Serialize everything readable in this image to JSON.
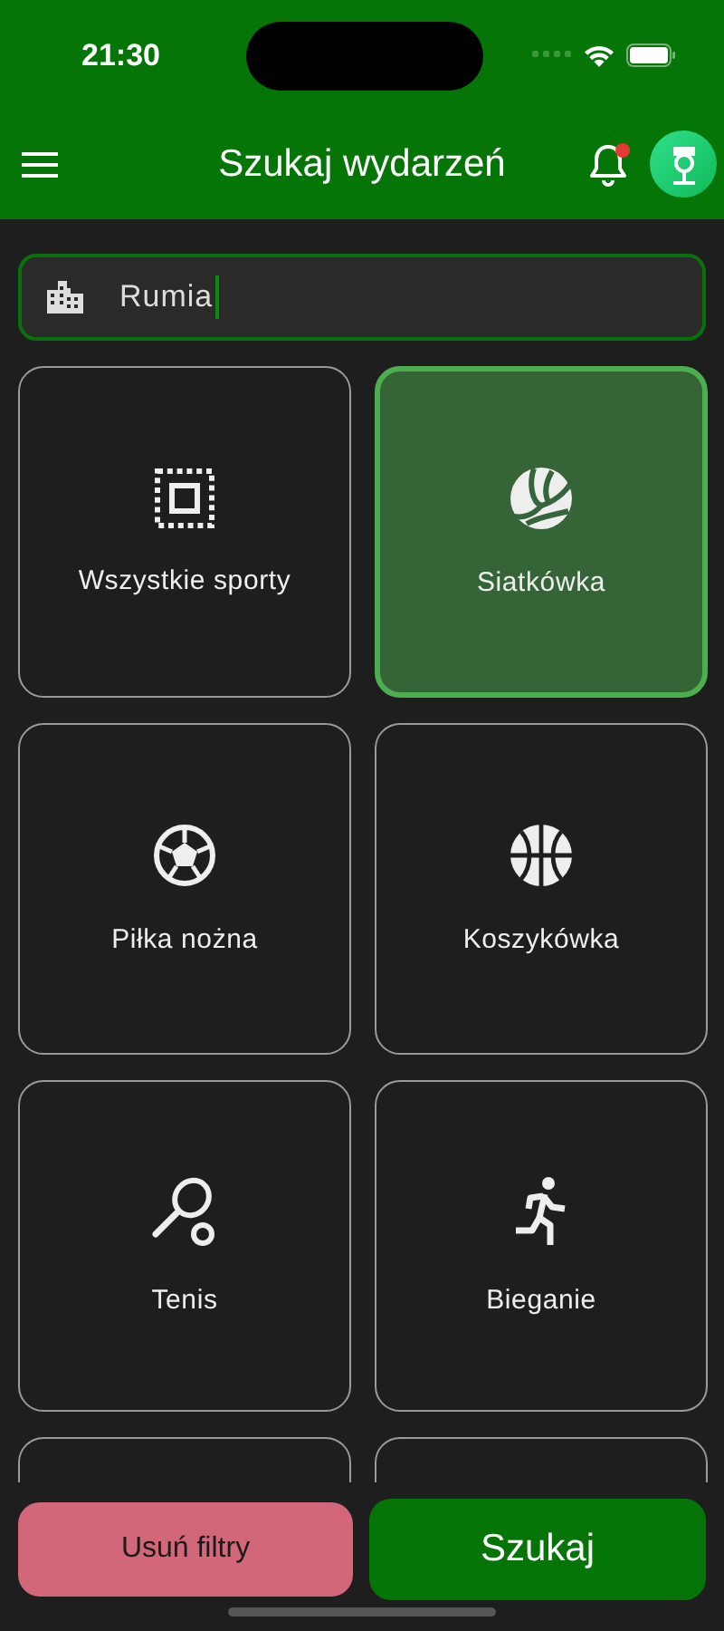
{
  "status_bar": {
    "time": "21:30"
  },
  "app_bar": {
    "title": "Szukaj wydarzeń",
    "notifications_unread": true
  },
  "location_field": {
    "value": "Rumia"
  },
  "sports": [
    {
      "kind": "all",
      "label": "Wszystkie sporty",
      "selected": false
    },
    {
      "kind": "volleyball",
      "label": "Siatkówka",
      "selected": true
    },
    {
      "kind": "football",
      "label": "Piłka nożna",
      "selected": false
    },
    {
      "kind": "basketball",
      "label": "Koszykówka",
      "selected": false
    },
    {
      "kind": "tennis",
      "label": "Tenis",
      "selected": false
    },
    {
      "kind": "running",
      "label": "Bieganie",
      "selected": false
    },
    {
      "kind": "hidden",
      "selected": false
    },
    {
      "kind": "hidden",
      "selected": false
    }
  ],
  "buttons": [
    {
      "kind": "clear",
      "label": "Usuń filtry"
    },
    {
      "kind": "search",
      "label": "Szukaj"
    }
  ]
}
